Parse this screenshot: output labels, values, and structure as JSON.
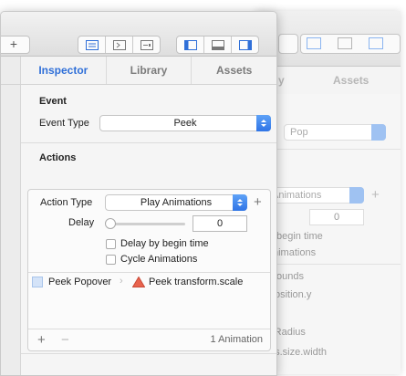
{
  "back_window": {
    "tabs": [
      "y",
      "Assets"
    ],
    "event_popup": "Pop",
    "action_popup": "Animations",
    "delay_value": "0",
    "faded_lines": [
      "begin time",
      "nimations",
      "ounds",
      "osition.y",
      "rRadius",
      "ds.size.width"
    ]
  },
  "toolbar": {
    "add_label": "+"
  },
  "tabs": {
    "inspector": "Inspector",
    "library": "Library",
    "assets": "Assets"
  },
  "event": {
    "title": "Event",
    "type_label": "Event Type",
    "type_value": "Peek"
  },
  "actions": {
    "title": "Actions",
    "action_type_label": "Action Type",
    "action_type_value": "Play Animations",
    "delay_label": "Delay",
    "delay_value": "0",
    "delay_by_begin_time": "Delay by begin time",
    "cycle_animations": "Cycle Animations",
    "animation_source": "Peek Popover",
    "animation_target": "Peek transform.scale",
    "footer_count": "1 Animation",
    "add_symbol": "+",
    "remove_symbol": "−"
  },
  "colors": {
    "accent": "#2f6fd8",
    "warning": "#e8634d"
  }
}
